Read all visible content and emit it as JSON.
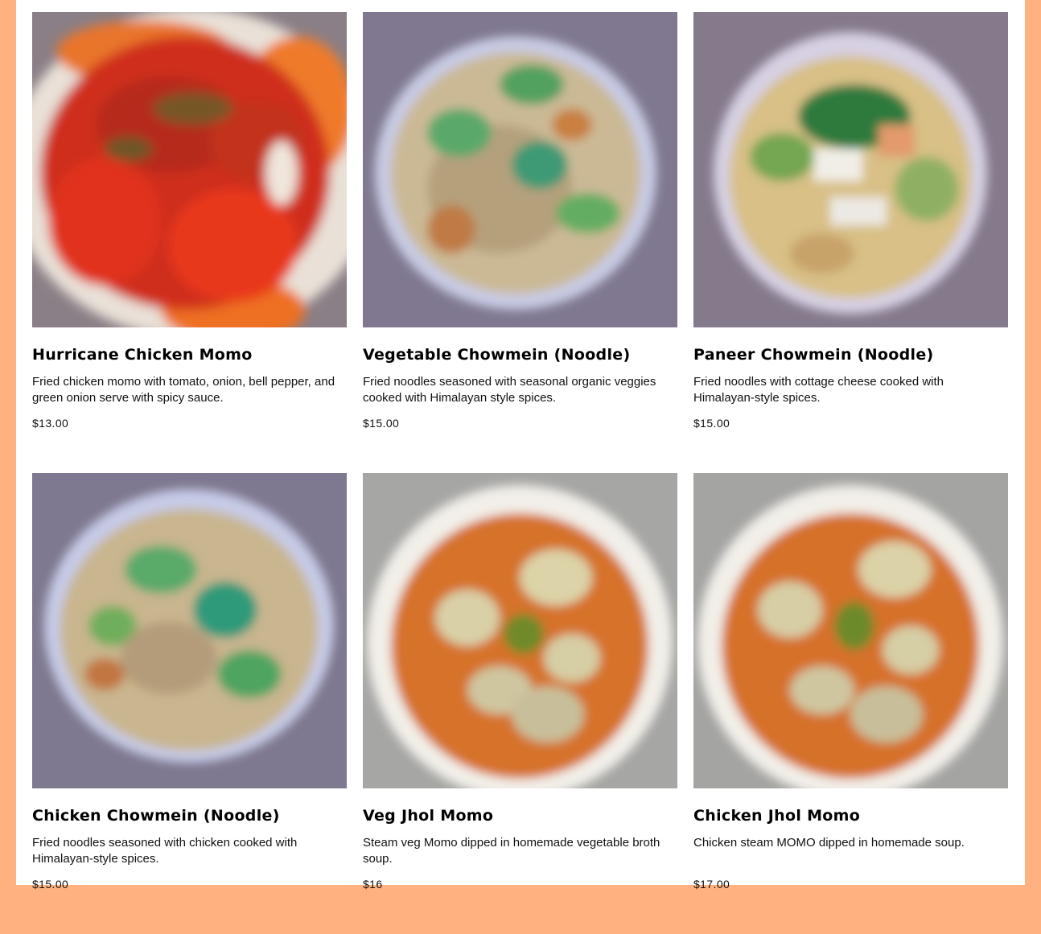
{
  "colors": {
    "page_background": "#FFB27F",
    "panel_background": "#FFFFFF"
  },
  "menu_items": [
    {
      "name": "Hurricane Chicken Momo",
      "description": "Fried chicken momo with tomato, onion, bell pepper, and green onion serve with spicy sauce.",
      "price": "$13.00",
      "photo": "hurricane-chicken-momo-photo"
    },
    {
      "name": "Vegetable Chowmein (Noodle)",
      "description": "Fried noodles seasoned with seasonal organic veggies cooked with Himalayan style spices.",
      "price": "$15.00",
      "photo": "vegetable-chowmein-photo"
    },
    {
      "name": "Paneer Chowmein (Noodle)",
      "description": "Fried noodles with cottage cheese cooked with Himalayan-style spices.",
      "price": "$15.00",
      "photo": "paneer-chowmein-photo"
    },
    {
      "name": "Chicken Chowmein (Noodle)",
      "description": "Fried noodles seasoned with chicken cooked with Himalayan-style spices.",
      "price": "$15.00",
      "photo": "chicken-chowmein-photo"
    },
    {
      "name": "Veg Jhol Momo",
      "description": "Steam veg Momo dipped in homemade vegetable broth soup.",
      "price": "$16",
      "photo": "veg-jhol-momo-photo"
    },
    {
      "name": "Chicken Jhol Momo",
      "description": "Chicken steam MOMO dipped in homemade soup.",
      "price": "$17.00",
      "photo": "chicken-jhol-momo-photo"
    }
  ]
}
